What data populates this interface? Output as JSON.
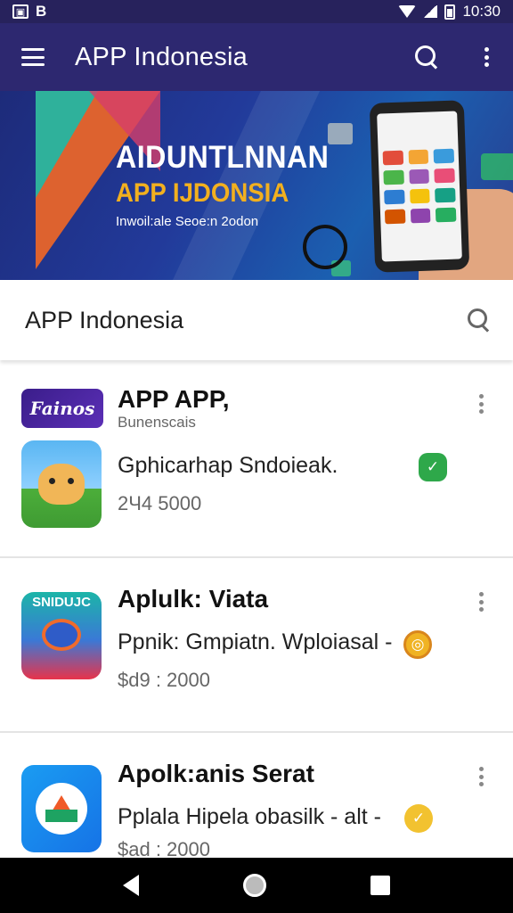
{
  "status_bar": {
    "left_icon_letter": "B",
    "time": "10:30"
  },
  "app_bar": {
    "title": "APP Indonesia"
  },
  "banner": {
    "line1": "AIDUNTLNNAN",
    "line2": "APP IJDONSIA",
    "line3": "Inwoil:ale Seoe:n 2odon"
  },
  "search": {
    "value": "APP Indonesia"
  },
  "apps": [
    {
      "logo_text": "Fainos",
      "title": "APP APP,",
      "subtitle": "Bunenscais",
      "description": "Gphicarhap Sndoieak.",
      "price": "2Ч4 5000",
      "badge_icon": "check-icon",
      "badge_color": "#2ea84a"
    },
    {
      "icon_text": "SNIDUJC",
      "title": "Aplulk: Viata",
      "description": "Ppnik: Gmpiatn. Wploiasal -",
      "price": "$d9 : 2000",
      "badge_icon": "target-icon",
      "badge_color": "#f0b323"
    },
    {
      "title": "Apolk:anis Serat",
      "description": "Pplala Hipela obasilk - alt -",
      "price": "$ad : 2000",
      "badge_icon": "check-icon",
      "badge_color": "#f2c230"
    }
  ],
  "colors": {
    "app_bar": "#2d2870",
    "status_bar": "#27225c"
  }
}
